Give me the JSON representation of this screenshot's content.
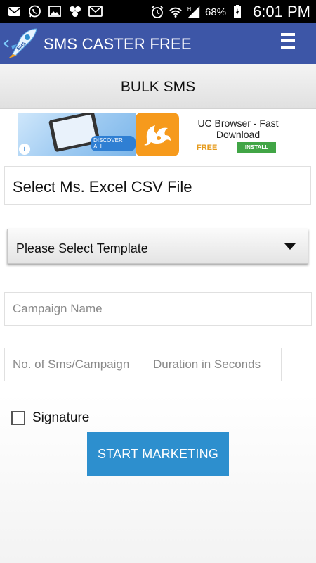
{
  "status_bar": {
    "battery_percent": "68%",
    "time": "6:01 PM",
    "left_icons": [
      "mail-icon",
      "whatsapp-icon",
      "image-icon",
      "dots-icon",
      "message-icon"
    ],
    "right_icons": [
      "alarm-icon",
      "wifi-icon",
      "signal-icon",
      "battery-icon"
    ]
  },
  "app_bar": {
    "title": "SMS CASTER FREE",
    "logo_text": "SMS",
    "menu_icon": "hamburger-menu-icon"
  },
  "page": {
    "title": "BULK SMS"
  },
  "ad": {
    "image_text": "DISCOVER ALL",
    "title": "UC Browser - Fast Download",
    "price": "FREE",
    "install_label": "INSTALL",
    "info_icon": "i"
  },
  "form": {
    "file_select_label": "Select Ms. Excel CSV File",
    "template_select": {
      "selected": "Please Select Template"
    },
    "campaign_name": {
      "value": "",
      "placeholder": "Campaign Name"
    },
    "sms_per_campaign": {
      "value": "",
      "placeholder": "No. of Sms/Campaign"
    },
    "duration": {
      "value": "",
      "placeholder": "Duration in Seconds"
    },
    "signature_label": "Signature",
    "signature_checked": false,
    "start_button": "START MARKETING"
  },
  "colors": {
    "app_bar": "#3d56a7",
    "button": "#2d8fce",
    "ad_install": "#41a546",
    "ad_free": "#e69b1c"
  }
}
